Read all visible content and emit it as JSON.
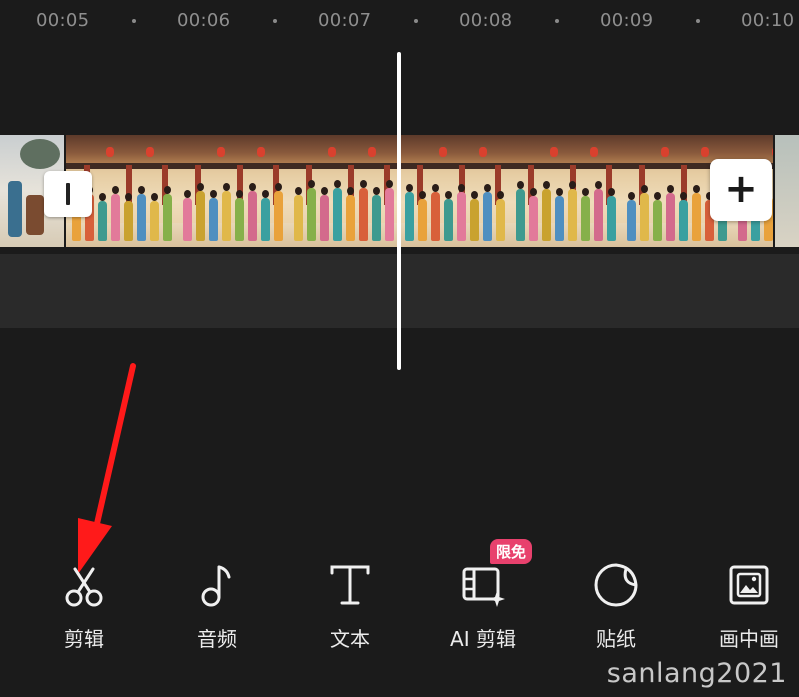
{
  "ruler": {
    "labels": [
      "00:05",
      "00:06",
      "00:07",
      "00:08",
      "00:09",
      "00:10"
    ]
  },
  "timeline": {
    "add_button_label": "+"
  },
  "toolbar": {
    "items": [
      {
        "label": "剪辑",
        "icon": "scissors-icon"
      },
      {
        "label": "音频",
        "icon": "music-note-icon"
      },
      {
        "label": "文本",
        "icon": "text-icon"
      },
      {
        "label": "AI 剪辑",
        "icon": "ai-film-edit-icon",
        "badge": "限免"
      },
      {
        "label": "贴纸",
        "icon": "sticker-icon"
      },
      {
        "label": "画中画",
        "icon": "picture-in-picture-icon"
      }
    ]
  },
  "annotation": {
    "arrow_color": "#ff1a1a"
  },
  "watermark": "sanlang2021",
  "colors": {
    "background": "#1b1b1b",
    "badge": "#e8416d",
    "playhead": "#ffffff"
  }
}
